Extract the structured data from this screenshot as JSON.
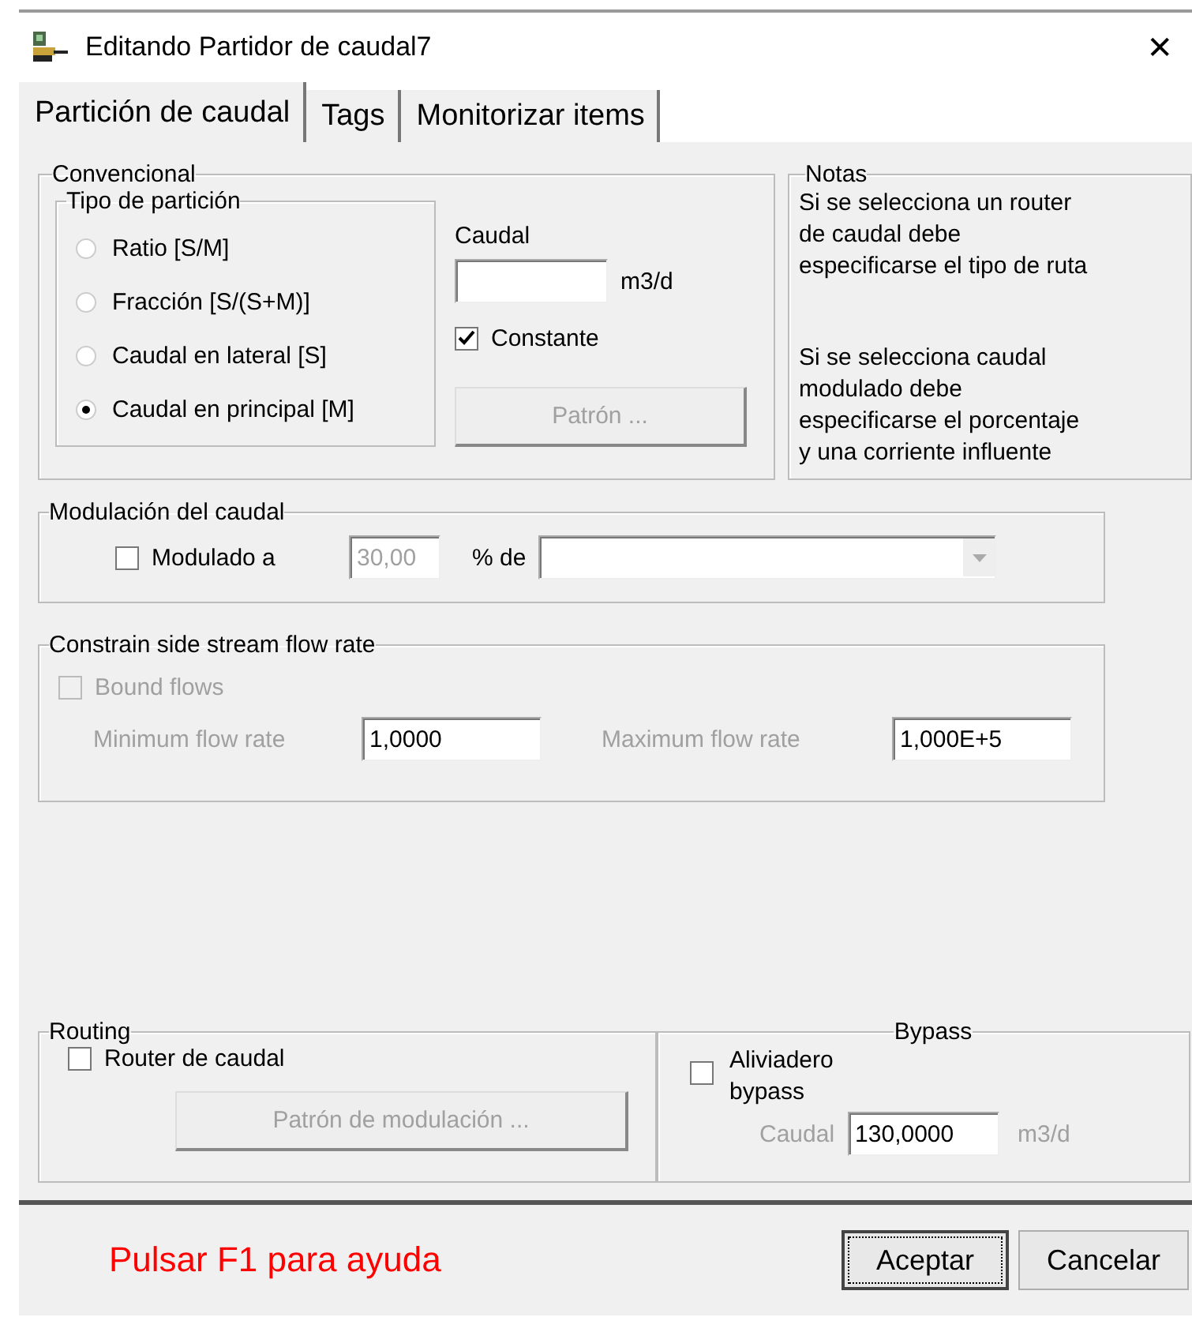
{
  "window": {
    "title": "Editando Partidor de caudal7",
    "close": "✕"
  },
  "tabs": [
    {
      "label": "Partición de caudal",
      "selected": true
    },
    {
      "label": "Tags",
      "selected": false
    },
    {
      "label": "Monitorizar items",
      "selected": false
    }
  ],
  "conventional": {
    "title": "Convencional",
    "partition_type": {
      "title": "Tipo de partición",
      "options": [
        {
          "label": "Ratio [S/M]",
          "selected": false
        },
        {
          "label": "Fracción [S/(S+M)]",
          "selected": false
        },
        {
          "label": "Caudal en lateral [S]",
          "selected": false
        },
        {
          "label": "Caudal en principal [M]",
          "selected": true
        }
      ]
    },
    "flow": {
      "label": "Caudal",
      "unit": "m3/d"
    },
    "constant": {
      "label": "Constante",
      "checked": true
    },
    "pattern_button": {
      "label": "Patrón ...",
      "disabled": true
    }
  },
  "notes": {
    "title": "Notas",
    "paragraphs": [
      [
        "Si se selecciona un router",
        "de caudal debe",
        "especificarse el tipo de ruta"
      ],
      [
        "Si se selecciona caudal",
        "modulado debe",
        "especificarse el porcentaje",
        "y una corriente influente"
      ]
    ]
  },
  "modulation": {
    "title": "Modulación del caudal",
    "checkbox": {
      "label": "Modulado a",
      "checked": false
    },
    "value": "30,00",
    "value_disabled": true,
    "percent_label": "% de",
    "dropdown": {
      "disabled": true
    }
  },
  "constrain": {
    "title": "Constrain side stream flow rate",
    "bound": {
      "label": "Bound flows",
      "checked": false,
      "disabled": true
    },
    "min_label": "Minimum flow rate",
    "min_value": "1,0000",
    "max_label": "Maximum flow rate",
    "max_value": "1,000E+5",
    "disabled": true
  },
  "routing": {
    "title": "Routing",
    "checkbox": {
      "label": "Router de caudal",
      "checked": false
    },
    "button": {
      "label": "Patrón de modulación ...",
      "disabled": true
    }
  },
  "bypass": {
    "title": "Bypass",
    "checkbox": {
      "label": "Aliviadero bypass",
      "checked": false
    },
    "flow_label": "Caudal",
    "flow_value": "130,0000",
    "unit": "m3/d",
    "disabled": true
  },
  "footer": {
    "help": "Pulsar F1 para ayuda",
    "buttons": [
      {
        "label": "Aceptar",
        "focused": true
      },
      {
        "label": "Cancelar",
        "focused": false
      }
    ]
  }
}
